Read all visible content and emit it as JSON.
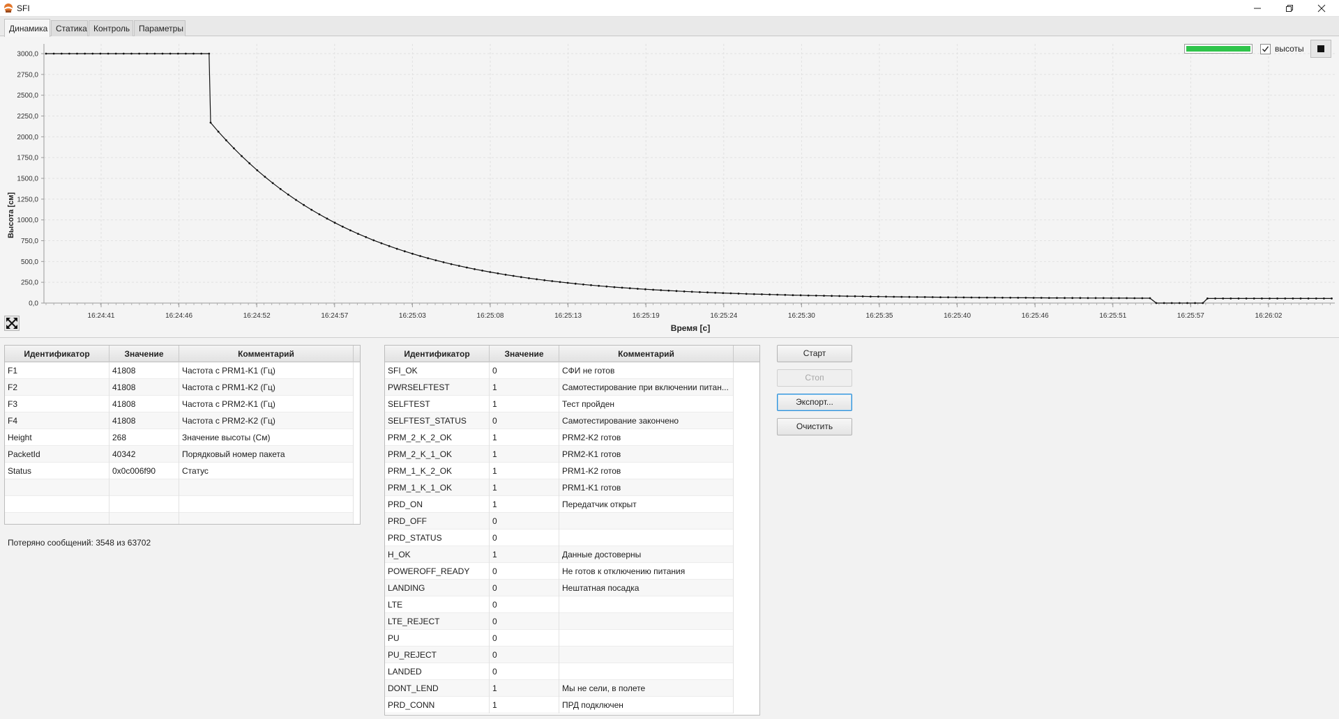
{
  "window": {
    "title": "SFI",
    "icon": "app-logo-icon"
  },
  "tabs": [
    {
      "label": "Динамика",
      "active": true
    },
    {
      "label": "Статика",
      "active": false
    },
    {
      "label": "Контроль",
      "active": false
    },
    {
      "label": "Параметры",
      "active": false
    }
  ],
  "chart_controls": {
    "progress_fraction": 1.0,
    "progress_color": "#2fc44b",
    "checkbox_checked": true,
    "checkbox_label": "высоты"
  },
  "chart_data": {
    "type": "line",
    "xlabel": "Время [c]",
    "ylabel": "Высота [см]",
    "ylim": [
      0,
      3000
    ],
    "yticks": [
      "0,0",
      "250,0",
      "500,0",
      "750,0",
      "1000,0",
      "1250,0",
      "1500,0",
      "1750,0",
      "2000,0",
      "2250,0",
      "2500,0",
      "2750,0",
      "3000,0"
    ],
    "xticks": [
      "16:24:41",
      "16:24:46",
      "16:24:52",
      "16:24:57",
      "16:25:03",
      "16:25:08",
      "16:25:13",
      "16:25:19",
      "16:25:24",
      "16:25:30",
      "16:25:35",
      "16:25:40",
      "16:25:46",
      "16:25:51",
      "16:25:57",
      "16:26:02"
    ],
    "grid": true,
    "markers": true,
    "line_color": "#111111",
    "xlim_seconds": [
      0,
      83
    ],
    "segments": [
      {
        "phase": "plateau",
        "t_start": 0,
        "t_end": 10.6,
        "value": 3000
      },
      {
        "phase": "drop",
        "t": 10.6,
        "to_value": 2170
      },
      {
        "phase": "decay",
        "t_start": 10.6,
        "t_end": 71.5,
        "from_value": 2170,
        "to_value": 55
      },
      {
        "phase": "zero",
        "t_start": 71.5,
        "t_end": 74.8,
        "value": 0
      },
      {
        "phase": "recovery",
        "t_start": 74.8,
        "t_end": 83,
        "value": 55
      }
    ]
  },
  "left_table": {
    "headers": [
      "Идентификатор",
      "Значение",
      "Комментарий"
    ],
    "rows": [
      [
        "F1",
        "41808",
        "Частота с PRM1-K1 (Гц)"
      ],
      [
        "F2",
        "41808",
        "Частота с PRM1-K2 (Гц)"
      ],
      [
        "F3",
        "41808",
        "Частота с PRM2-K1 (Гц)"
      ],
      [
        "F4",
        "41808",
        "Частота с PRM2-K2 (Гц)"
      ],
      [
        "Height",
        "268",
        "Значение высоты (См)"
      ],
      [
        "PacketId",
        "40342",
        "Порядковый номер пакета"
      ],
      [
        "Status",
        "0x0c006f90",
        "Статус"
      ],
      [
        "",
        "",
        ""
      ],
      [
        "",
        "",
        ""
      ],
      [
        "",
        "",
        ""
      ]
    ]
  },
  "lost_messages": "Потеряно сообщений: 3548 из 63702",
  "right_table": {
    "headers": [
      "Идентификатор",
      "Значение",
      "Комментарий"
    ],
    "rows": [
      [
        "SFI_OK",
        "0",
        "СФИ не готов"
      ],
      [
        "PWRSELFTEST",
        "1",
        "Самотестирование при включении питан..."
      ],
      [
        "SELFTEST",
        "1",
        "Тест пройден"
      ],
      [
        "SELFTEST_STATUS",
        "0",
        "Самотестирование закончено"
      ],
      [
        "PRM_2_K_2_OK",
        "1",
        "PRM2-K2 готов"
      ],
      [
        "PRM_2_K_1_OK",
        "1",
        "PRM2-K1 готов"
      ],
      [
        "PRM_1_K_2_OK",
        "1",
        "PRM1-K2 готов"
      ],
      [
        "PRM_1_K_1_OK",
        "1",
        "PRM1-K1 готов"
      ],
      [
        "PRD_ON",
        "1",
        "Передатчик открыт"
      ],
      [
        "PRD_OFF",
        "0",
        ""
      ],
      [
        "PRD_STATUS",
        "0",
        ""
      ],
      [
        "H_OK",
        "1",
        "Данные достоверны"
      ],
      [
        "POWEROFF_READY",
        "0",
        "Не готов к отключению питания"
      ],
      [
        "LANDING",
        "0",
        "Нештатная посадка"
      ],
      [
        "LTE",
        "0",
        ""
      ],
      [
        "LTE_REJECT",
        "0",
        ""
      ],
      [
        "PU",
        "0",
        ""
      ],
      [
        "PU_REJECT",
        "0",
        ""
      ],
      [
        "LANDED",
        "0",
        ""
      ],
      [
        "DONT_LEND",
        "1",
        "Мы не сели, в полете"
      ],
      [
        "PRD_CONN",
        "1",
        "ПРД подключен"
      ]
    ]
  },
  "buttons": {
    "start": "Старт",
    "stop": "Стоп",
    "export": "Экспорт...",
    "clear": "Очистить"
  }
}
